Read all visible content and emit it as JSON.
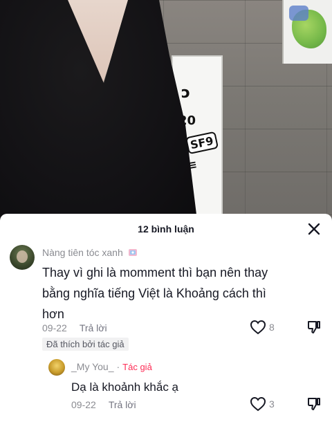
{
  "comments_header": {
    "title": "12 bình luận"
  },
  "comments": [
    {
      "username": "Nàng tiên tóc xanh",
      "username_suffix_icon": "sparkle-sticker-icon",
      "text": "Thay vì ghi là momment thì bạn nên thay bằng nghĩa tiếng Việt là Khoảng cách thì hơn",
      "date": "09-22",
      "reply_label": "Trả lời",
      "like_count": "8",
      "liked_by_author_badge": "Đã thích bởi tác giả"
    },
    {
      "username": "_My You_",
      "separator": "·",
      "author_tag": "Tác giả",
      "text": "Dạ là khoảnh khắc ạ",
      "date": "09-22",
      "reply_label": "Trả lời",
      "like_count": "3"
    }
  ],
  "video": {
    "sticker_texts": [
      "SF9"
    ]
  },
  "colors": {
    "accent": "#fe2c55",
    "secondary_text": "#8a8b91",
    "primary_text": "#161823"
  }
}
